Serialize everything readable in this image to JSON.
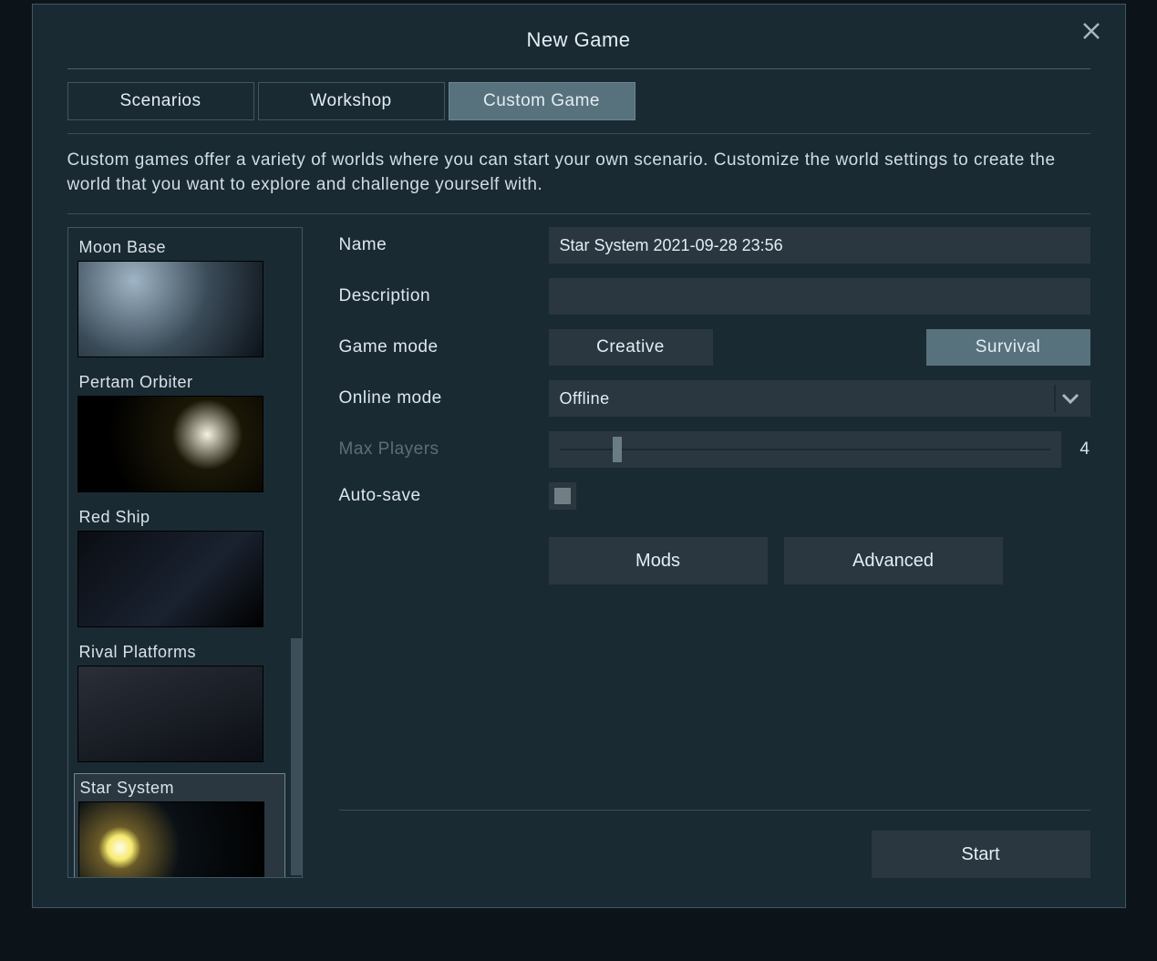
{
  "header": {
    "title": "New Game"
  },
  "tabs": [
    {
      "label": "Scenarios",
      "active": false
    },
    {
      "label": "Workshop",
      "active": false
    },
    {
      "label": "Custom Game",
      "active": true
    }
  ],
  "description": "Custom games offer a variety of worlds where you can start your own scenario. Customize the world settings to create the world that you want to explore and challenge yourself with.",
  "scenarios": [
    {
      "label": "Moon Base",
      "selected": false,
      "thumb": "thumb-moon"
    },
    {
      "label": "Pertam Orbiter",
      "selected": false,
      "thumb": "thumb-pertam"
    },
    {
      "label": "Red Ship",
      "selected": false,
      "thumb": "thumb-red"
    },
    {
      "label": "Rival Platforms",
      "selected": false,
      "thumb": "thumb-rival"
    },
    {
      "label": "Star System",
      "selected": true,
      "thumb": "thumb-star"
    }
  ],
  "form": {
    "name_label": "Name",
    "name_value": "Star System 2021-09-28 23:56",
    "description_label": "Description",
    "description_value": "",
    "gamemode_label": "Game mode",
    "gamemode": {
      "creative_label": "Creative",
      "survival_label": "Survival",
      "selected": "survival"
    },
    "onlinemode_label": "Online mode",
    "onlinemode_value": "Offline",
    "maxplayers_label": "Max Players",
    "maxplayers_value": "4",
    "autosave_label": "Auto-save",
    "autosave_checked": true,
    "mods_label": "Mods",
    "advanced_label": "Advanced"
  },
  "footer": {
    "start_label": "Start"
  }
}
